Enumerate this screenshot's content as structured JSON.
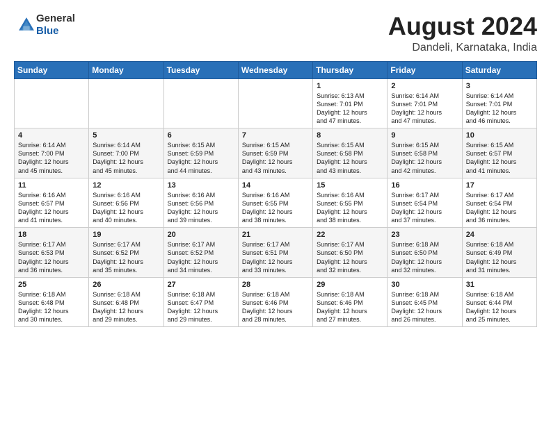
{
  "header": {
    "logo": {
      "general": "General",
      "blue": "Blue"
    },
    "title": "August 2024",
    "location": "Dandeli, Karnataka, India"
  },
  "calendar": {
    "weekdays": [
      "Sunday",
      "Monday",
      "Tuesday",
      "Wednesday",
      "Thursday",
      "Friday",
      "Saturday"
    ],
    "weeks": [
      [
        {
          "day": "",
          "info": ""
        },
        {
          "day": "",
          "info": ""
        },
        {
          "day": "",
          "info": ""
        },
        {
          "day": "",
          "info": ""
        },
        {
          "day": "1",
          "info": "Sunrise: 6:13 AM\nSunset: 7:01 PM\nDaylight: 12 hours\nand 47 minutes."
        },
        {
          "day": "2",
          "info": "Sunrise: 6:14 AM\nSunset: 7:01 PM\nDaylight: 12 hours\nand 47 minutes."
        },
        {
          "day": "3",
          "info": "Sunrise: 6:14 AM\nSunset: 7:01 PM\nDaylight: 12 hours\nand 46 minutes."
        }
      ],
      [
        {
          "day": "4",
          "info": "Sunrise: 6:14 AM\nSunset: 7:00 PM\nDaylight: 12 hours\nand 45 minutes."
        },
        {
          "day": "5",
          "info": "Sunrise: 6:14 AM\nSunset: 7:00 PM\nDaylight: 12 hours\nand 45 minutes."
        },
        {
          "day": "6",
          "info": "Sunrise: 6:15 AM\nSunset: 6:59 PM\nDaylight: 12 hours\nand 44 minutes."
        },
        {
          "day": "7",
          "info": "Sunrise: 6:15 AM\nSunset: 6:59 PM\nDaylight: 12 hours\nand 43 minutes."
        },
        {
          "day": "8",
          "info": "Sunrise: 6:15 AM\nSunset: 6:58 PM\nDaylight: 12 hours\nand 43 minutes."
        },
        {
          "day": "9",
          "info": "Sunrise: 6:15 AM\nSunset: 6:58 PM\nDaylight: 12 hours\nand 42 minutes."
        },
        {
          "day": "10",
          "info": "Sunrise: 6:15 AM\nSunset: 6:57 PM\nDaylight: 12 hours\nand 41 minutes."
        }
      ],
      [
        {
          "day": "11",
          "info": "Sunrise: 6:16 AM\nSunset: 6:57 PM\nDaylight: 12 hours\nand 41 minutes."
        },
        {
          "day": "12",
          "info": "Sunrise: 6:16 AM\nSunset: 6:56 PM\nDaylight: 12 hours\nand 40 minutes."
        },
        {
          "day": "13",
          "info": "Sunrise: 6:16 AM\nSunset: 6:56 PM\nDaylight: 12 hours\nand 39 minutes."
        },
        {
          "day": "14",
          "info": "Sunrise: 6:16 AM\nSunset: 6:55 PM\nDaylight: 12 hours\nand 38 minutes."
        },
        {
          "day": "15",
          "info": "Sunrise: 6:16 AM\nSunset: 6:55 PM\nDaylight: 12 hours\nand 38 minutes."
        },
        {
          "day": "16",
          "info": "Sunrise: 6:17 AM\nSunset: 6:54 PM\nDaylight: 12 hours\nand 37 minutes."
        },
        {
          "day": "17",
          "info": "Sunrise: 6:17 AM\nSunset: 6:54 PM\nDaylight: 12 hours\nand 36 minutes."
        }
      ],
      [
        {
          "day": "18",
          "info": "Sunrise: 6:17 AM\nSunset: 6:53 PM\nDaylight: 12 hours\nand 36 minutes."
        },
        {
          "day": "19",
          "info": "Sunrise: 6:17 AM\nSunset: 6:52 PM\nDaylight: 12 hours\nand 35 minutes."
        },
        {
          "day": "20",
          "info": "Sunrise: 6:17 AM\nSunset: 6:52 PM\nDaylight: 12 hours\nand 34 minutes."
        },
        {
          "day": "21",
          "info": "Sunrise: 6:17 AM\nSunset: 6:51 PM\nDaylight: 12 hours\nand 33 minutes."
        },
        {
          "day": "22",
          "info": "Sunrise: 6:17 AM\nSunset: 6:50 PM\nDaylight: 12 hours\nand 32 minutes."
        },
        {
          "day": "23",
          "info": "Sunrise: 6:18 AM\nSunset: 6:50 PM\nDaylight: 12 hours\nand 32 minutes."
        },
        {
          "day": "24",
          "info": "Sunrise: 6:18 AM\nSunset: 6:49 PM\nDaylight: 12 hours\nand 31 minutes."
        }
      ],
      [
        {
          "day": "25",
          "info": "Sunrise: 6:18 AM\nSunset: 6:48 PM\nDaylight: 12 hours\nand 30 minutes."
        },
        {
          "day": "26",
          "info": "Sunrise: 6:18 AM\nSunset: 6:48 PM\nDaylight: 12 hours\nand 29 minutes."
        },
        {
          "day": "27",
          "info": "Sunrise: 6:18 AM\nSunset: 6:47 PM\nDaylight: 12 hours\nand 29 minutes."
        },
        {
          "day": "28",
          "info": "Sunrise: 6:18 AM\nSunset: 6:46 PM\nDaylight: 12 hours\nand 28 minutes."
        },
        {
          "day": "29",
          "info": "Sunrise: 6:18 AM\nSunset: 6:46 PM\nDaylight: 12 hours\nand 27 minutes."
        },
        {
          "day": "30",
          "info": "Sunrise: 6:18 AM\nSunset: 6:45 PM\nDaylight: 12 hours\nand 26 minutes."
        },
        {
          "day": "31",
          "info": "Sunrise: 6:18 AM\nSunset: 6:44 PM\nDaylight: 12 hours\nand 25 minutes."
        }
      ]
    ]
  }
}
